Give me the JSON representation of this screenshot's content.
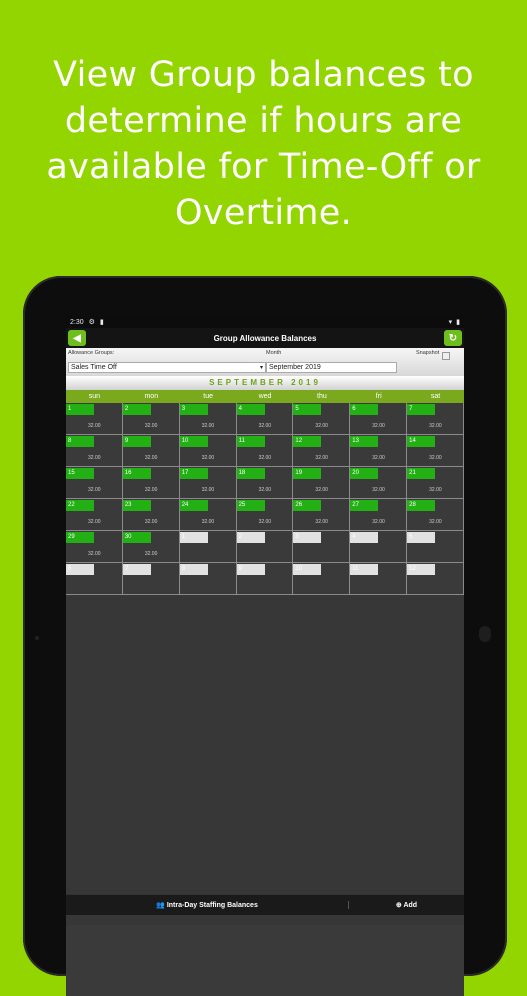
{
  "headline": "View Group balances to determine if hours are available for Time-Off or Overtime.",
  "status": {
    "time": "2:30",
    "icons_left": [
      "gear-icon",
      "sim-icon"
    ],
    "icons_right": [
      "wifi-icon",
      "battery-icon"
    ]
  },
  "appbar": {
    "title": "Group Allowance Balances",
    "back_icon": "back-arrow-icon",
    "refresh_icon": "refresh-icon"
  },
  "filters": {
    "allowance_label": "Allowance Groups:",
    "allowance_value": "Sales Time Off",
    "month_label": "Month",
    "month_value": "September 2019",
    "snapshot_label": "Snapshot"
  },
  "calendar": {
    "title": "SEPTEMBER 2019",
    "days": [
      "sun",
      "mon",
      "tue",
      "wed",
      "thu",
      "fri",
      "sat"
    ],
    "cells": [
      {
        "n": "1",
        "b": "32.00"
      },
      {
        "n": "2",
        "b": "32.00"
      },
      {
        "n": "3",
        "b": "32.00"
      },
      {
        "n": "4",
        "b": "32.00"
      },
      {
        "n": "5",
        "b": "32.00"
      },
      {
        "n": "6",
        "b": "32.00"
      },
      {
        "n": "7",
        "b": "32.00"
      },
      {
        "n": "8",
        "b": "32.00"
      },
      {
        "n": "9",
        "b": "32.00"
      },
      {
        "n": "10",
        "b": "32.00"
      },
      {
        "n": "11",
        "b": "32.00"
      },
      {
        "n": "12",
        "b": "32.00"
      },
      {
        "n": "13",
        "b": "32.00"
      },
      {
        "n": "14",
        "b": "32.00"
      },
      {
        "n": "15",
        "b": "32.00"
      },
      {
        "n": "16",
        "b": "32.00"
      },
      {
        "n": "17",
        "b": "32.00"
      },
      {
        "n": "18",
        "b": "32.00"
      },
      {
        "n": "19",
        "b": "32.00"
      },
      {
        "n": "20",
        "b": "32.00"
      },
      {
        "n": "21",
        "b": "32.00"
      },
      {
        "n": "22",
        "b": "32.00"
      },
      {
        "n": "23",
        "b": "32.00"
      },
      {
        "n": "24",
        "b": "32.00"
      },
      {
        "n": "25",
        "b": "32.00"
      },
      {
        "n": "26",
        "b": "32.00"
      },
      {
        "n": "27",
        "b": "32.00"
      },
      {
        "n": "28",
        "b": "32.00"
      },
      {
        "n": "29",
        "b": "32.00"
      },
      {
        "n": "30",
        "b": "32.00"
      },
      {
        "n": "1",
        "b": "",
        "o": true
      },
      {
        "n": "2",
        "b": "",
        "o": true
      },
      {
        "n": "3",
        "b": "",
        "o": true
      },
      {
        "n": "4",
        "b": "",
        "o": true
      },
      {
        "n": "5",
        "b": "",
        "o": true
      },
      {
        "n": "6",
        "b": "",
        "o": true
      },
      {
        "n": "7",
        "b": "",
        "o": true
      },
      {
        "n": "8",
        "b": "",
        "o": true
      },
      {
        "n": "9",
        "b": "",
        "o": true
      },
      {
        "n": "10",
        "b": "",
        "o": true
      },
      {
        "n": "11",
        "b": "",
        "o": true
      },
      {
        "n": "12",
        "b": "",
        "o": true
      }
    ]
  },
  "bottom": {
    "staffing_label": "Intra-Day Staffing Balances",
    "add_label": "Add",
    "staffing_icon": "people-icon",
    "add_icon": "plus-circle-icon"
  },
  "colors": {
    "background": "#93d500",
    "accent": "#6ebf1d",
    "day_badge": "#22b014"
  }
}
